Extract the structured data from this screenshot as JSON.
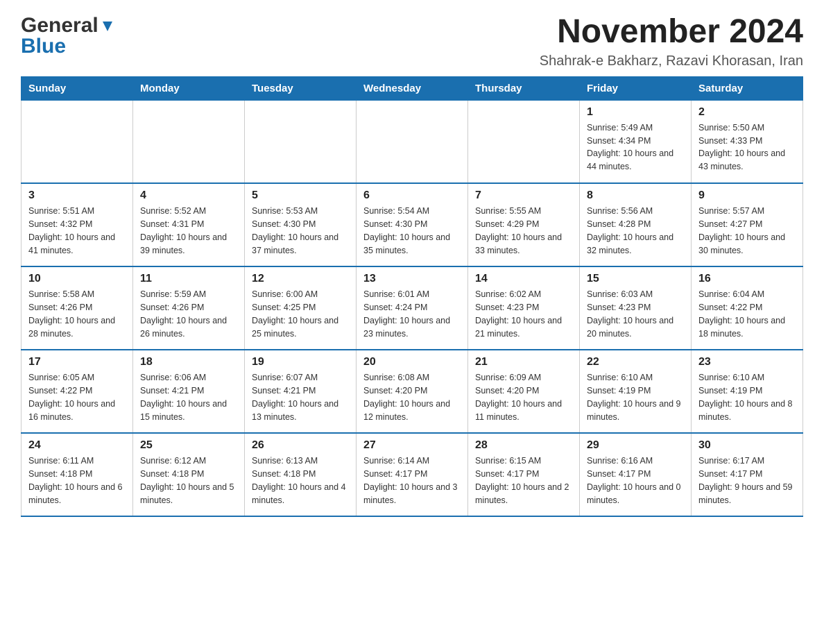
{
  "header": {
    "logo_general": "General",
    "logo_blue": "Blue",
    "month_title": "November 2024",
    "location": "Shahrak-e Bakharz, Razavi Khorasan, Iran"
  },
  "days_of_week": [
    "Sunday",
    "Monday",
    "Tuesday",
    "Wednesday",
    "Thursday",
    "Friday",
    "Saturday"
  ],
  "weeks": [
    [
      {
        "day": "",
        "sunrise": "",
        "sunset": "",
        "daylight": ""
      },
      {
        "day": "",
        "sunrise": "",
        "sunset": "",
        "daylight": ""
      },
      {
        "day": "",
        "sunrise": "",
        "sunset": "",
        "daylight": ""
      },
      {
        "day": "",
        "sunrise": "",
        "sunset": "",
        "daylight": ""
      },
      {
        "day": "",
        "sunrise": "",
        "sunset": "",
        "daylight": ""
      },
      {
        "day": "1",
        "sunrise": "Sunrise: 5:49 AM",
        "sunset": "Sunset: 4:34 PM",
        "daylight": "Daylight: 10 hours and 44 minutes."
      },
      {
        "day": "2",
        "sunrise": "Sunrise: 5:50 AM",
        "sunset": "Sunset: 4:33 PM",
        "daylight": "Daylight: 10 hours and 43 minutes."
      }
    ],
    [
      {
        "day": "3",
        "sunrise": "Sunrise: 5:51 AM",
        "sunset": "Sunset: 4:32 PM",
        "daylight": "Daylight: 10 hours and 41 minutes."
      },
      {
        "day": "4",
        "sunrise": "Sunrise: 5:52 AM",
        "sunset": "Sunset: 4:31 PM",
        "daylight": "Daylight: 10 hours and 39 minutes."
      },
      {
        "day": "5",
        "sunrise": "Sunrise: 5:53 AM",
        "sunset": "Sunset: 4:30 PM",
        "daylight": "Daylight: 10 hours and 37 minutes."
      },
      {
        "day": "6",
        "sunrise": "Sunrise: 5:54 AM",
        "sunset": "Sunset: 4:30 PM",
        "daylight": "Daylight: 10 hours and 35 minutes."
      },
      {
        "day": "7",
        "sunrise": "Sunrise: 5:55 AM",
        "sunset": "Sunset: 4:29 PM",
        "daylight": "Daylight: 10 hours and 33 minutes."
      },
      {
        "day": "8",
        "sunrise": "Sunrise: 5:56 AM",
        "sunset": "Sunset: 4:28 PM",
        "daylight": "Daylight: 10 hours and 32 minutes."
      },
      {
        "day": "9",
        "sunrise": "Sunrise: 5:57 AM",
        "sunset": "Sunset: 4:27 PM",
        "daylight": "Daylight: 10 hours and 30 minutes."
      }
    ],
    [
      {
        "day": "10",
        "sunrise": "Sunrise: 5:58 AM",
        "sunset": "Sunset: 4:26 PM",
        "daylight": "Daylight: 10 hours and 28 minutes."
      },
      {
        "day": "11",
        "sunrise": "Sunrise: 5:59 AM",
        "sunset": "Sunset: 4:26 PM",
        "daylight": "Daylight: 10 hours and 26 minutes."
      },
      {
        "day": "12",
        "sunrise": "Sunrise: 6:00 AM",
        "sunset": "Sunset: 4:25 PM",
        "daylight": "Daylight: 10 hours and 25 minutes."
      },
      {
        "day": "13",
        "sunrise": "Sunrise: 6:01 AM",
        "sunset": "Sunset: 4:24 PM",
        "daylight": "Daylight: 10 hours and 23 minutes."
      },
      {
        "day": "14",
        "sunrise": "Sunrise: 6:02 AM",
        "sunset": "Sunset: 4:23 PM",
        "daylight": "Daylight: 10 hours and 21 minutes."
      },
      {
        "day": "15",
        "sunrise": "Sunrise: 6:03 AM",
        "sunset": "Sunset: 4:23 PM",
        "daylight": "Daylight: 10 hours and 20 minutes."
      },
      {
        "day": "16",
        "sunrise": "Sunrise: 6:04 AM",
        "sunset": "Sunset: 4:22 PM",
        "daylight": "Daylight: 10 hours and 18 minutes."
      }
    ],
    [
      {
        "day": "17",
        "sunrise": "Sunrise: 6:05 AM",
        "sunset": "Sunset: 4:22 PM",
        "daylight": "Daylight: 10 hours and 16 minutes."
      },
      {
        "day": "18",
        "sunrise": "Sunrise: 6:06 AM",
        "sunset": "Sunset: 4:21 PM",
        "daylight": "Daylight: 10 hours and 15 minutes."
      },
      {
        "day": "19",
        "sunrise": "Sunrise: 6:07 AM",
        "sunset": "Sunset: 4:21 PM",
        "daylight": "Daylight: 10 hours and 13 minutes."
      },
      {
        "day": "20",
        "sunrise": "Sunrise: 6:08 AM",
        "sunset": "Sunset: 4:20 PM",
        "daylight": "Daylight: 10 hours and 12 minutes."
      },
      {
        "day": "21",
        "sunrise": "Sunrise: 6:09 AM",
        "sunset": "Sunset: 4:20 PM",
        "daylight": "Daylight: 10 hours and 11 minutes."
      },
      {
        "day": "22",
        "sunrise": "Sunrise: 6:10 AM",
        "sunset": "Sunset: 4:19 PM",
        "daylight": "Daylight: 10 hours and 9 minutes."
      },
      {
        "day": "23",
        "sunrise": "Sunrise: 6:10 AM",
        "sunset": "Sunset: 4:19 PM",
        "daylight": "Daylight: 10 hours and 8 minutes."
      }
    ],
    [
      {
        "day": "24",
        "sunrise": "Sunrise: 6:11 AM",
        "sunset": "Sunset: 4:18 PM",
        "daylight": "Daylight: 10 hours and 6 minutes."
      },
      {
        "day": "25",
        "sunrise": "Sunrise: 6:12 AM",
        "sunset": "Sunset: 4:18 PM",
        "daylight": "Daylight: 10 hours and 5 minutes."
      },
      {
        "day": "26",
        "sunrise": "Sunrise: 6:13 AM",
        "sunset": "Sunset: 4:18 PM",
        "daylight": "Daylight: 10 hours and 4 minutes."
      },
      {
        "day": "27",
        "sunrise": "Sunrise: 6:14 AM",
        "sunset": "Sunset: 4:17 PM",
        "daylight": "Daylight: 10 hours and 3 minutes."
      },
      {
        "day": "28",
        "sunrise": "Sunrise: 6:15 AM",
        "sunset": "Sunset: 4:17 PM",
        "daylight": "Daylight: 10 hours and 2 minutes."
      },
      {
        "day": "29",
        "sunrise": "Sunrise: 6:16 AM",
        "sunset": "Sunset: 4:17 PM",
        "daylight": "Daylight: 10 hours and 0 minutes."
      },
      {
        "day": "30",
        "sunrise": "Sunrise: 6:17 AM",
        "sunset": "Sunset: 4:17 PM",
        "daylight": "Daylight: 9 hours and 59 minutes."
      }
    ]
  ]
}
